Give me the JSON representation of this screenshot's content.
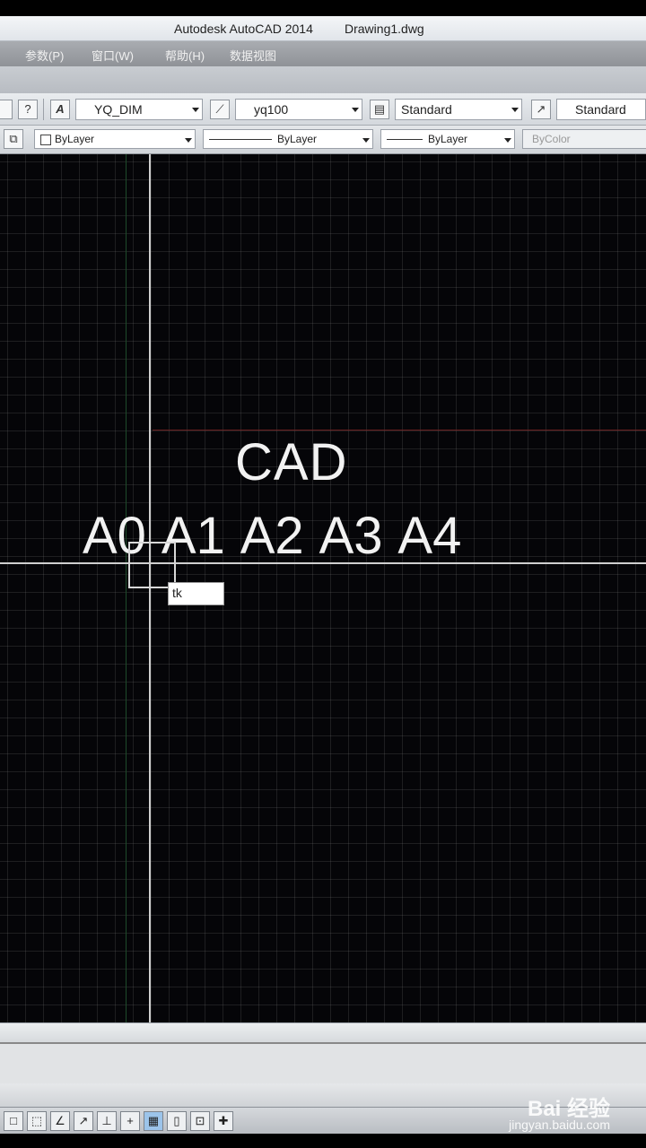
{
  "window": {
    "app_title": "Autodesk AutoCAD 2014",
    "file_name": "Drawing1.dwg"
  },
  "menu": {
    "items": [
      "参数(P)",
      "窗口(W)",
      "帮助(H)",
      "数据视图"
    ]
  },
  "styles_toolbar": {
    "text_style": "YQ_DIM",
    "dim_style": "yq100",
    "table_style": "Standard",
    "multileader_style": "Standard"
  },
  "properties_toolbar": {
    "color": "ByLayer",
    "linetype": "ByLayer",
    "lineweight": "ByLayer",
    "plot_style": "ByColor"
  },
  "drawing": {
    "title_text": "CAD",
    "sizes_text": "A0 A1 A2 A3 A4",
    "dynamic_input_value": "tk"
  },
  "icons": {
    "help": "?",
    "status": [
      "□",
      "⬚",
      "∠",
      "↗",
      "⊥",
      "+",
      "▦",
      "▯",
      "⊡",
      "✚"
    ]
  },
  "watermark": {
    "brand": "Bai 经验",
    "url": "jingyan.baidu.com"
  },
  "colors": {
    "canvas": "#050508",
    "crosshair": "#cfcfcf"
  }
}
